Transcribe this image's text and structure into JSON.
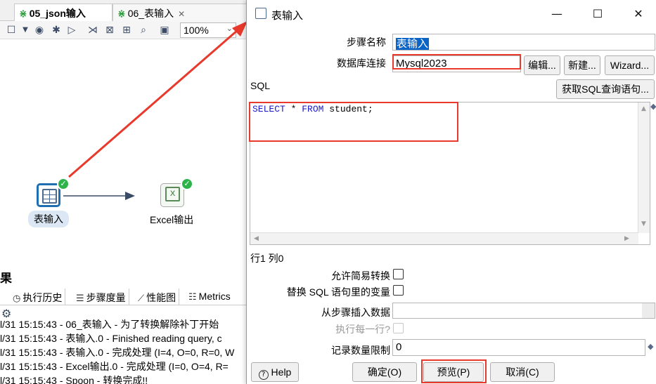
{
  "background": {
    "tabs": [
      {
        "label": "05_json输入"
      },
      {
        "label": "06_表输入"
      }
    ],
    "zoom": "100%",
    "canvas": {
      "step1_label": "表输入",
      "step2_label": "Excel输出",
      "step2_glyph": "X"
    },
    "results": {
      "title": "果",
      "tabs": [
        {
          "label": "执行历史"
        },
        {
          "label": "步骤度量"
        },
        {
          "label": "性能图"
        },
        {
          "label": "Metrics"
        }
      ],
      "log": [
        "l/31 15:15:43 - 06_表输入 - 为了转换解除补丁开始",
        "l/31 15:15:43 - 表输入.0 - Finished reading query, c",
        "l/31 15:15:43 - 表输入.0 - 完成处理 (I=4, O=0, R=0, W",
        "l/31 15:15:43 - Excel输出.0 - 完成处理 (I=0, O=4, R=",
        "l/31 15:15:43 - Spoon - 转换完成!!"
      ]
    }
  },
  "dialog": {
    "title": "表输入",
    "step_name_label": "步骤名称",
    "step_name_value": "表输入",
    "db_conn_label": "数据库连接",
    "db_conn_value": "Mysql2023",
    "edit_button": "编辑...",
    "new_button": "新建...",
    "wizard_button": "Wizard...",
    "sql_label": "SQL",
    "get_sql_button": "获取SQL查询语句...",
    "sql": {
      "kw1": "SELECT",
      "mid": " * ",
      "kw2": "FROM",
      "rest": " student;"
    },
    "position_status": "行1 列0",
    "lazy_conversion_label": "允许简易转换",
    "replace_vars_label": "替换 SQL 语句里的变量",
    "insert_from_step_label": "从步骤插入数据",
    "execute_each_row_label": "执行每一行?",
    "limit_label": "记录数量限制",
    "limit_value": "0",
    "help_button": "Help",
    "ok_button": "确定(O)",
    "preview_button": "预览(P)",
    "cancel_button": "取消(C)"
  },
  "colors": {
    "highlight_red": "#e8392c",
    "selection_blue": "#0a64c8",
    "check_green": "#2db34a"
  }
}
